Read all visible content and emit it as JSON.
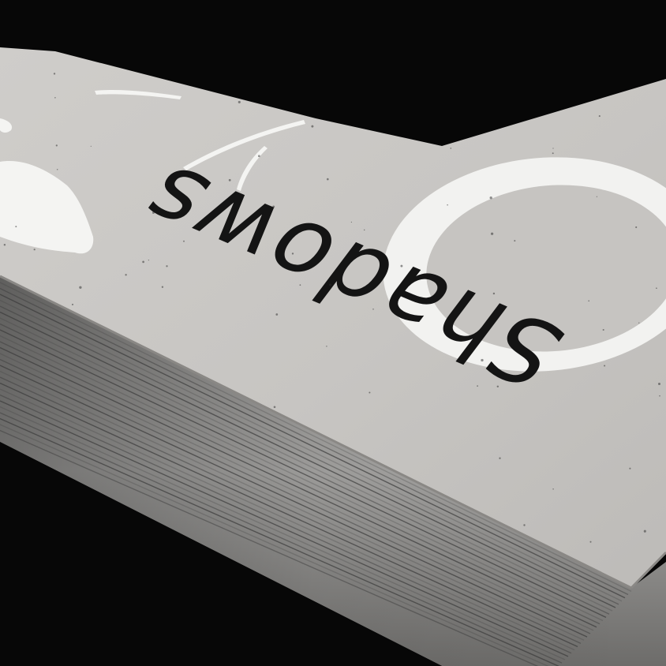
{
  "photo": {
    "subject": "book-corner-closeup",
    "cover_title": "Shadows",
    "cover_title_orientation": "upside-down",
    "colors": {
      "background": "#070707",
      "cover": "#c9c7c4",
      "cover_shadow": "#b8b6b3",
      "ink": "#141414",
      "white_print": "#f2f2f0",
      "page_edges": "#9e9d9b",
      "page_lines": "#3a3a3a"
    }
  }
}
